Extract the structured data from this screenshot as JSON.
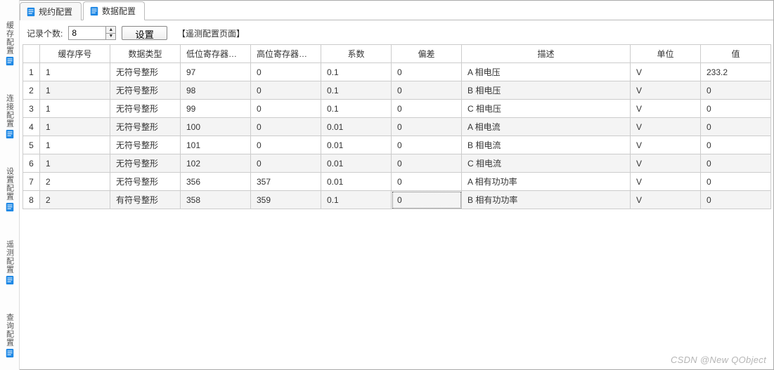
{
  "tabs": [
    {
      "label": "规约配置",
      "active": false
    },
    {
      "label": "数据配置",
      "active": true
    }
  ],
  "sidebar": {
    "items": [
      {
        "label": "缓存配置"
      },
      {
        "label": "连接配置"
      },
      {
        "label": "设置配置"
      },
      {
        "label": "遥测配置"
      },
      {
        "label": "查询配置"
      }
    ]
  },
  "toolbar": {
    "record_count_label": "记录个数:",
    "record_count_value": "8",
    "set_button": "设置",
    "page_hint": "【遥测配置页面】"
  },
  "columns": [
    "缓存序号",
    "数据类型",
    "低位寄存器地址",
    "高位寄存器地址",
    "系数",
    "偏差",
    "描述",
    "单位",
    "值"
  ],
  "rows": [
    {
      "cache": "1",
      "type": "无符号整形",
      "low": "97",
      "high": "0",
      "coef": "0.1",
      "bias": "0",
      "desc": "A 相电压",
      "unit": "V",
      "val": "233.2"
    },
    {
      "cache": "1",
      "type": "无符号整形",
      "low": "98",
      "high": "0",
      "coef": "0.1",
      "bias": "0",
      "desc": "B 相电压",
      "unit": "V",
      "val": "0"
    },
    {
      "cache": "1",
      "type": "无符号整形",
      "low": "99",
      "high": "0",
      "coef": "0.1",
      "bias": "0",
      "desc": "C 相电压",
      "unit": "V",
      "val": "0"
    },
    {
      "cache": "1",
      "type": "无符号整形",
      "low": "100",
      "high": "0",
      "coef": "0.01",
      "bias": "0",
      "desc": "A 相电流",
      "unit": "V",
      "val": "0"
    },
    {
      "cache": "1",
      "type": "无符号整形",
      "low": "101",
      "high": "0",
      "coef": "0.01",
      "bias": "0",
      "desc": "B 相电流",
      "unit": "V",
      "val": "0"
    },
    {
      "cache": "1",
      "type": "无符号整形",
      "low": "102",
      "high": "0",
      "coef": "0.01",
      "bias": "0",
      "desc": "C 相电流",
      "unit": "V",
      "val": "0"
    },
    {
      "cache": "2",
      "type": "无符号整形",
      "low": "356",
      "high": "357",
      "coef": "0.01",
      "bias": "0",
      "desc": "A 相有功功率",
      "unit": "V",
      "val": "0"
    },
    {
      "cache": "2",
      "type": "有符号整形",
      "low": "358",
      "high": "359",
      "coef": "0.1",
      "bias": "0",
      "desc": "B 相有功功率",
      "unit": "V",
      "val": "0"
    }
  ],
  "focus": {
    "row": 7,
    "col": "bias"
  },
  "watermark": "CSDN @New QObject",
  "icon_color": "#1e88e5",
  "col_widths": [
    "24px",
    "100px",
    "100px",
    "100px",
    "100px",
    "100px",
    "100px",
    "240px",
    "100px",
    "100px"
  ]
}
